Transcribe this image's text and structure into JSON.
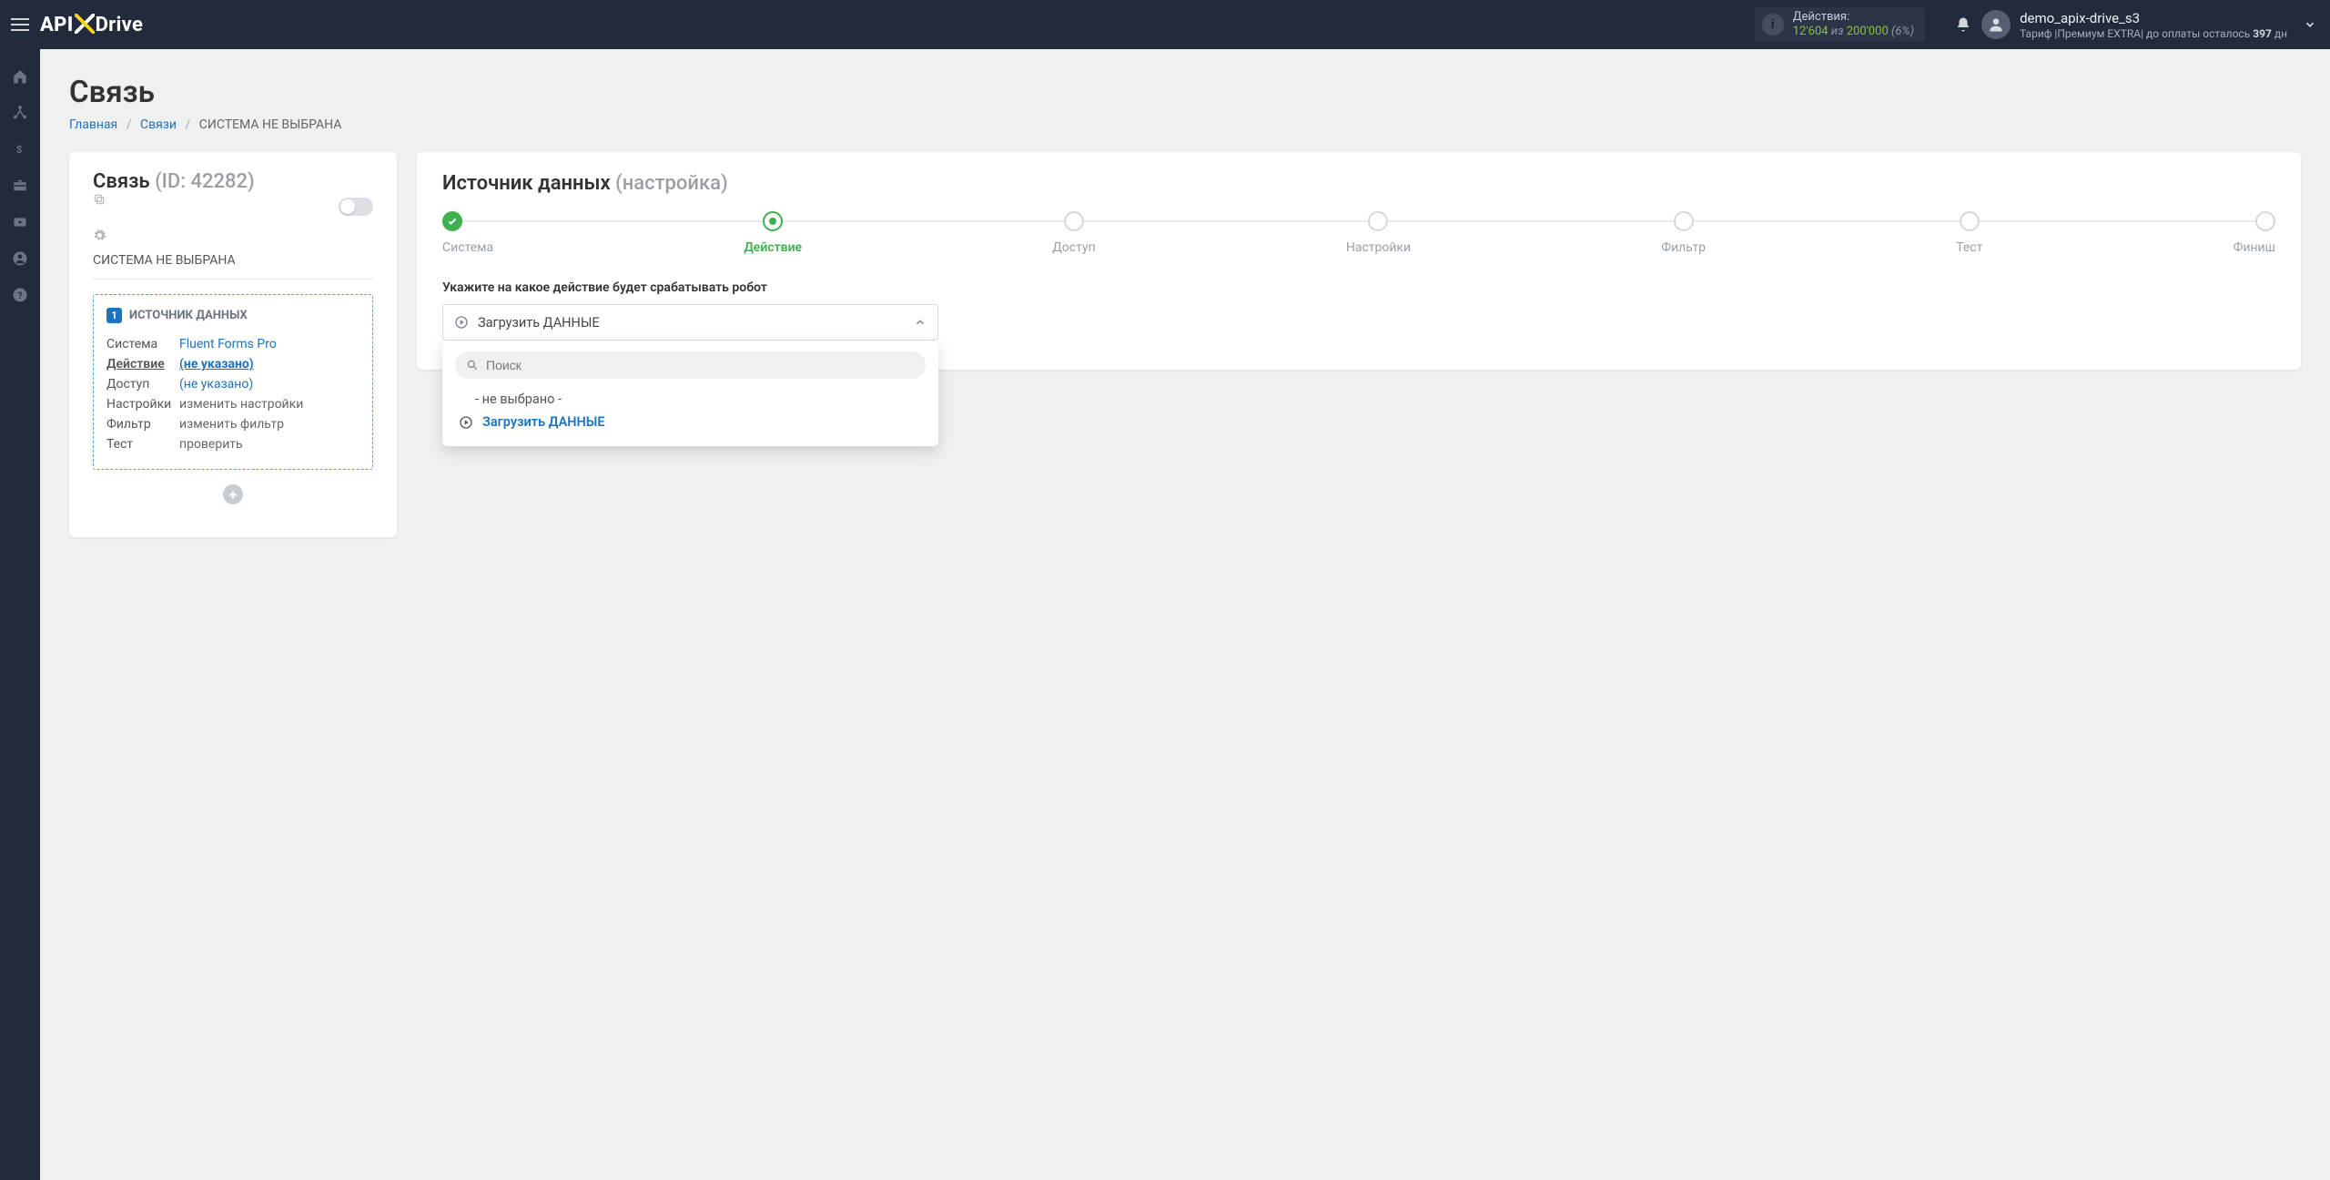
{
  "topbar": {
    "logo_api": "API",
    "logo_drive": "Drive",
    "actions_label": "Действия:",
    "actions_used": "12'604",
    "actions_of": "из",
    "actions_total": "200'000",
    "actions_pct": "(6%)",
    "user_name": "demo_apix-drive_s3",
    "tariff_prefix": "Тариф |Премиум EXTRA| до оплаты осталось ",
    "tariff_days": "397",
    "tariff_suffix": " дн"
  },
  "page": {
    "title": "Связь",
    "crumb_home": "Главная",
    "crumb_links": "Связи",
    "crumb_current": "СИСТЕМА НЕ ВЫБРАНА"
  },
  "linkcard": {
    "title": "Связь",
    "id_label": "(ID: 42282)",
    "subtitle": "СИСТЕМА НЕ ВЫБРАНА",
    "box_num": "1",
    "box_title": "ИСТОЧНИК ДАННЫХ",
    "rows": {
      "system_k": "Система",
      "system_v": "Fluent Forms Pro",
      "action_k": "Действие",
      "action_v": "(не указано)",
      "access_k": "Доступ",
      "access_v": "(не указано)",
      "settings_k": "Настройки",
      "settings_v": "изменить настройки",
      "filter_k": "Фильтр",
      "filter_v": "изменить фильтр",
      "test_k": "Тест",
      "test_v": "проверить"
    }
  },
  "main": {
    "title": "Источник данных",
    "title_sub": "(настройка)",
    "steps": [
      "Система",
      "Действие",
      "Доступ",
      "Настройки",
      "Фильтр",
      "Тест",
      "Финиш"
    ],
    "form_label": "Укажите на какое действие будет срабатывать робот",
    "dd_selected": "Загрузить ДАННЫЕ",
    "dd_search_placeholder": "Поиск",
    "dd_opt_none": "- не выбрано -",
    "dd_opt_load": "Загрузить ДАННЫЕ"
  }
}
